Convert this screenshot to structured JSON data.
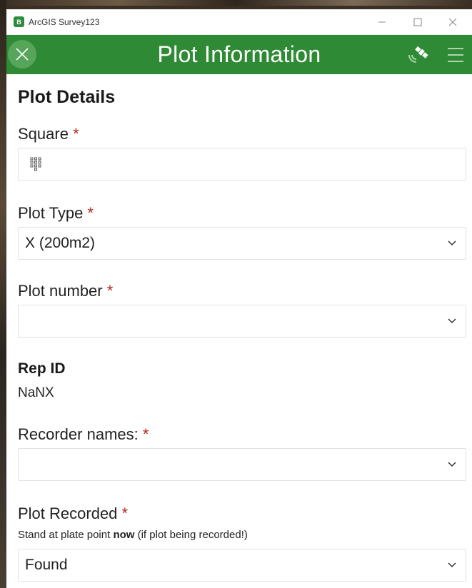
{
  "window": {
    "app_title": "ArcGIS Survey123",
    "minimize_icon": "minimize-icon",
    "maximize_icon": "maximize-icon",
    "close_icon": "close-icon"
  },
  "header": {
    "title": "Plot Information",
    "close_icon": "close-x-icon",
    "gps_icon": "satellite-gps-icon",
    "menu_icon": "hamburger-menu-icon",
    "color": "#2f8a35"
  },
  "form": {
    "group_title": "Plot Details",
    "required_marker": "*",
    "square": {
      "label": "Square ",
      "value": "",
      "icon": "numeric-keypad-icon"
    },
    "plot_type": {
      "label": "Plot Type ",
      "value": "X (200m2)"
    },
    "plot_number": {
      "label": "Plot number ",
      "value": ""
    },
    "rep_id": {
      "label": "Rep ID",
      "value": "NaNX"
    },
    "recorder_names": {
      "label": "Recorder names: ",
      "value": ""
    },
    "plot_recorded": {
      "label": "Plot Recorded ",
      "hint_before": "Stand at plate point ",
      "hint_bold": "now",
      "hint_after": " (if plot being recorded!)",
      "value": "Found"
    }
  }
}
